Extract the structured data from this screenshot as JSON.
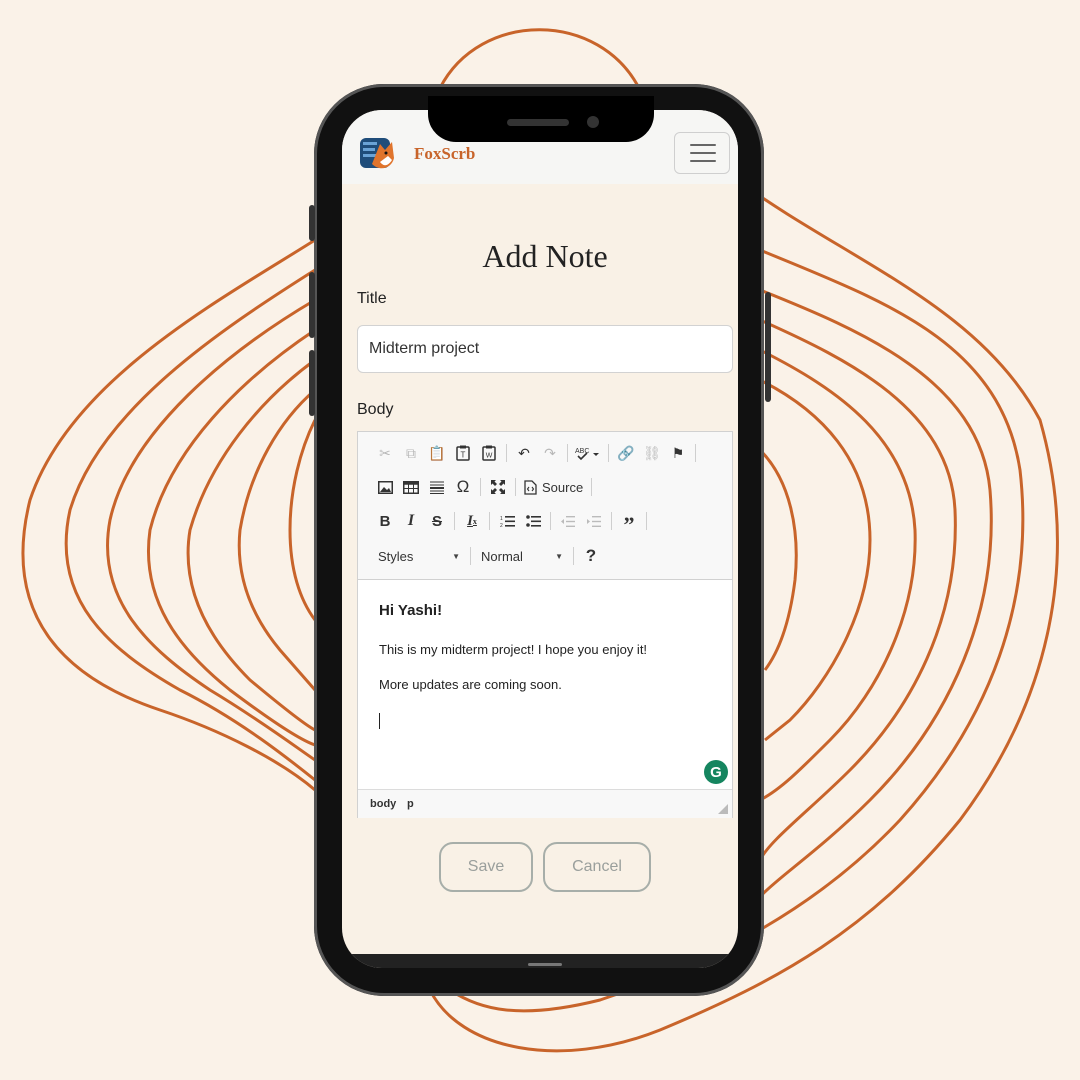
{
  "colors": {
    "background": "#faf2e8",
    "line_accent": "#c8642a",
    "brand": "#c8642a",
    "screen_bg": "#f9f1e6",
    "button_border": "#a7aea9",
    "grammarly": "#15855f"
  },
  "navbar": {
    "brand": "FoxScrb",
    "logo_icon": "fox-logo-icon",
    "menu_icon": "hamburger-menu-icon"
  },
  "page": {
    "title": "Add Note"
  },
  "form": {
    "title_label": "Title",
    "title_value": "Midterm project",
    "body_label": "Body"
  },
  "editor": {
    "toolbar": {
      "row1": [
        "cut-icon",
        "copy-icon",
        "paste-icon",
        "paste-text-icon",
        "paste-word-icon",
        "undo-icon",
        "redo-icon",
        "spellcheck-icon",
        "link-icon",
        "unlink-icon",
        "anchor-icon"
      ],
      "row2": [
        "image-icon",
        "table-icon",
        "horizontal-line-icon",
        "special-char-icon",
        "maximize-icon",
        "source-icon"
      ],
      "source_label": "Source",
      "row3": [
        "bold-icon",
        "italic-icon",
        "strike-icon",
        "remove-format-icon",
        "numbered-list-icon",
        "bulleted-list-icon",
        "outdent-icon",
        "indent-icon",
        "blockquote-icon"
      ],
      "styles_label": "Styles",
      "format_label": "Normal",
      "help_label": "?"
    },
    "content": {
      "heading": "Hi Yashi!",
      "paragraph1": "This is my midterm project! I hope you enjoy it!",
      "paragraph2": "More updates are coming soon."
    },
    "grammarly_label": "G",
    "path": [
      "body",
      "p"
    ]
  },
  "actions": {
    "save": "Save",
    "cancel": "Cancel"
  }
}
